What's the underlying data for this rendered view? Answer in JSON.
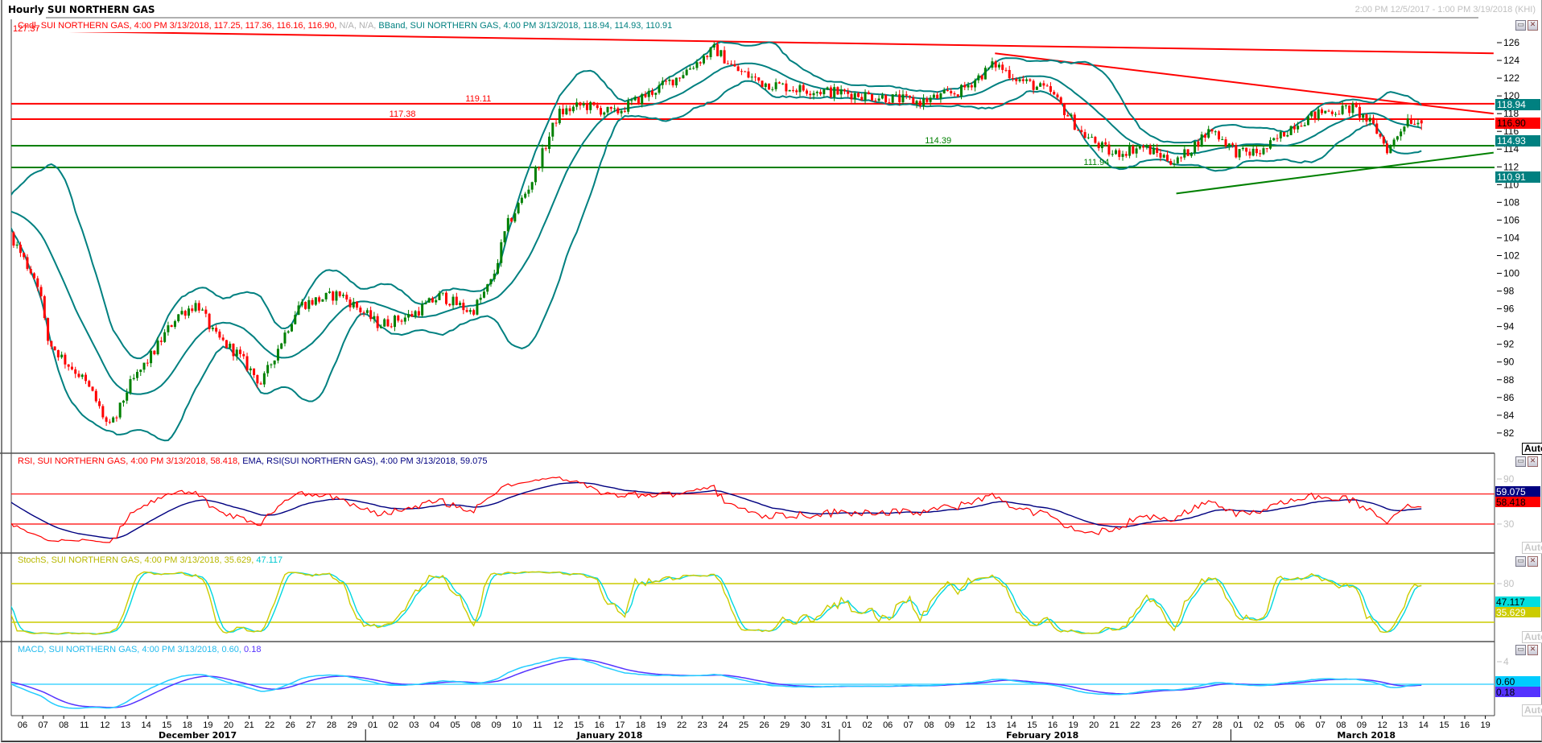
{
  "window": {
    "title": "Hourly SUI NORTHERN GAS",
    "range": "2:00 PM 12/5/2017 - 1:00 PM 3/19/2018 (KHI)"
  },
  "legends": {
    "main_cndl": "Cndl, SUI NORTHERN GAS, 4:00 PM 3/13/2018, 117.25, 117.36, 116.16, 116.90,",
    "main_na": "N/A, N/A,",
    "main_bband": "BBand, SUI NORTHERN GAS, 4:00 PM 3/13/2018, 118.94, 114.93, 110.91",
    "rsi_a": "RSI, SUI NORTHERN GAS, 4:00 PM 3/13/2018, 58.418,",
    "rsi_b": "EMA, RSI(SUI NORTHERN GAS), 4:00 PM 3/13/2018, 59.075",
    "stoch_a": "StochS, SUI NORTHERN GAS, 4:00 PM 3/13/2018, 35.629,",
    "stoch_b": "47.117",
    "macd_a": "MACD, SUI NORTHERN GAS, 4:00 PM 3/13/2018, 0.60,",
    "macd_b": "0.18"
  },
  "buttons": {
    "minimize": "▭",
    "close": "✕",
    "auto": "Auto"
  },
  "flags": {
    "bb_upper": "118.94",
    "last_price": "116.90",
    "bb_mid": "114.93",
    "bb_lower": "110.91",
    "rsi_ema": "59.075",
    "rsi": "58.418",
    "stoch_d": "47.117",
    "stoch_k": "35.629",
    "macd": "0.60",
    "signal": "0.18"
  },
  "colors": {
    "up": "#008000",
    "down": "#ff0000",
    "bband": "#008080",
    "rsi": "#ff0000",
    "rsi_ema": "#000080",
    "stoch_k": "#cccc00",
    "stoch_d": "#00d8e0",
    "macd": "#22ccff",
    "signal": "#5533ff",
    "support": "#008000",
    "resistance": "#ff0000"
  },
  "chart_data": [
    {
      "panel": "price",
      "type": "line",
      "subtype": "candlestick",
      "title": "Hourly SUI NORTHERN GAS",
      "bars_per_day": 6,
      "start_day": -0.6,
      "end_day": 67.95,
      "close_path": [
        [
          -0.6,
          104.5
        ],
        [
          0.2,
          101
        ],
        [
          0.8,
          98.7
        ],
        [
          1.2,
          92.5
        ],
        [
          2.1,
          90
        ],
        [
          2.8,
          88.5
        ],
        [
          3.4,
          86.4
        ],
        [
          4.2,
          82.5
        ],
        [
          4.6,
          84
        ],
        [
          5.1,
          87
        ],
        [
          6.3,
          90.9
        ],
        [
          7.5,
          95.3
        ],
        [
          8.5,
          96.6
        ],
        [
          9.3,
          93
        ],
        [
          10.4,
          91
        ],
        [
          11.6,
          87.5
        ],
        [
          12.4,
          91.6
        ],
        [
          13.4,
          96.4
        ],
        [
          15.4,
          97.7
        ],
        [
          16.1,
          96.4
        ],
        [
          17.3,
          94.2
        ],
        [
          18.8,
          95.2
        ],
        [
          20.3,
          97.5
        ],
        [
          21.8,
          95.6
        ],
        [
          22.8,
          99.2
        ],
        [
          23.5,
          105.3
        ],
        [
          24.7,
          110.3
        ],
        [
          26.0,
          118
        ],
        [
          27.2,
          119
        ],
        [
          28.7,
          118
        ],
        [
          30.2,
          120
        ],
        [
          31.7,
          122
        ],
        [
          33.6,
          125.3
        ],
        [
          34.6,
          123
        ],
        [
          35.9,
          121.5
        ],
        [
          37.6,
          120.8
        ],
        [
          40,
          120.3
        ],
        [
          42,
          119.8
        ],
        [
          43.5,
          119.3
        ],
        [
          45.5,
          120.5
        ],
        [
          47.2,
          123.6
        ],
        [
          48.4,
          121.8
        ],
        [
          49.9,
          120.4
        ],
        [
          51.4,
          115.8
        ],
        [
          52.9,
          113.4
        ],
        [
          54.3,
          114.3
        ],
        [
          56.0,
          112.5
        ],
        [
          57.7,
          116.3
        ],
        [
          59,
          113.5
        ],
        [
          60.2,
          113.7
        ],
        [
          61.7,
          116.8
        ],
        [
          63.1,
          118.2
        ],
        [
          64.6,
          118.6
        ],
        [
          65.6,
          116.5
        ],
        [
          66.3,
          113.8
        ],
        [
          67.2,
          117.5
        ],
        [
          67.95,
          116.9
        ]
      ],
      "last_bar": {
        "time": "4:00 PM 3/13/2018",
        "open": 117.25,
        "high": 117.36,
        "low": 116.16,
        "close": 116.9
      },
      "bollinger": {
        "period": 20,
        "stddev": 2,
        "upper": 118.94,
        "middle": 114.93,
        "lower": 110.91
      },
      "ylim": [
        81,
        128
      ],
      "yticks": [
        82,
        84,
        86,
        88,
        90,
        92,
        94,
        96,
        98,
        100,
        102,
        104,
        106,
        108,
        110,
        112,
        114,
        116,
        118,
        120,
        122,
        124,
        126
      ],
      "bold_ticks": [
        100,
        120
      ],
      "hlines": [
        {
          "price": 119.11,
          "label": "119.11",
          "color": "resistance",
          "label_day": 21.5
        },
        {
          "price": 117.38,
          "label": "117.38",
          "color": "resistance",
          "label_day": 17.8
        },
        {
          "price": 114.39,
          "label": "114.39",
          "color": "support",
          "label_day": 43.8
        },
        {
          "price": 111.94,
          "label": "111.94",
          "color": "support",
          "label_day": 51.5
        }
      ],
      "trendlines": [
        {
          "label": "127.37",
          "from": [
            -0.55,
            127.37
          ],
          "to": [
            71.4,
            124.8
          ],
          "color": "resistance"
        },
        {
          "label": "",
          "from": [
            26.7,
            127.45
          ],
          "to": [
            71.4,
            127.45
          ],
          "color": "resistance"
        },
        {
          "label": "",
          "from": [
            47.2,
            124.8
          ],
          "to": [
            71.4,
            118.0
          ],
          "color": "resistance"
        },
        {
          "label": "",
          "from": [
            56.0,
            109.0
          ],
          "to": [
            71.4,
            113.6
          ],
          "color": "support"
        }
      ]
    },
    {
      "panel": "rsi",
      "type": "line",
      "period": 14,
      "ema_period": 20,
      "rsi": 58.418,
      "ema": 59.075,
      "levels": [
        70,
        30
      ],
      "yticks": [
        90,
        30
      ],
      "ylim": [
        -8,
        108
      ]
    },
    {
      "panel": "stochastic",
      "type": "line",
      "k_period": 14,
      "slowing": 3,
      "d_period": 3,
      "k": 35.629,
      "d": 47.117,
      "levels": [
        80,
        20
      ],
      "yticks": [
        80
      ],
      "ylim": [
        -15,
        125
      ]
    },
    {
      "panel": "macd",
      "type": "line",
      "fast": 12,
      "slow": 26,
      "signal_period": 9,
      "macd": 0.6,
      "signal": 0.18,
      "yticks": [
        4
      ],
      "ylim": [
        -5.5,
        7
      ]
    }
  ],
  "x_axis": {
    "days": [
      "06",
      "07",
      "08",
      "11",
      "12",
      "13",
      "14",
      "15",
      "18",
      "19",
      "20",
      "21",
      "22",
      "26",
      "27",
      "28",
      "29",
      "01",
      "02",
      "03",
      "04",
      "05",
      "08",
      "09",
      "10",
      "11",
      "12",
      "15",
      "16",
      "17",
      "18",
      "19",
      "22",
      "23",
      "24",
      "25",
      "26",
      "29",
      "30",
      "31",
      "01",
      "02",
      "06",
      "07",
      "08",
      "09",
      "12",
      "13",
      "14",
      "15",
      "16",
      "19",
      "20",
      "21",
      "22",
      "23",
      "26",
      "27",
      "28",
      "01",
      "02",
      "05",
      "06",
      "07",
      "08",
      "09",
      "12",
      "13",
      "14",
      "15",
      "16",
      "19"
    ],
    "months": [
      {
        "label": "December 2017",
        "start_index": 0
      },
      {
        "label": "January 2018",
        "start_index": 17
      },
      {
        "label": "February 2018",
        "start_index": 40
      },
      {
        "label": "March 2018",
        "start_index": 59
      }
    ]
  }
}
